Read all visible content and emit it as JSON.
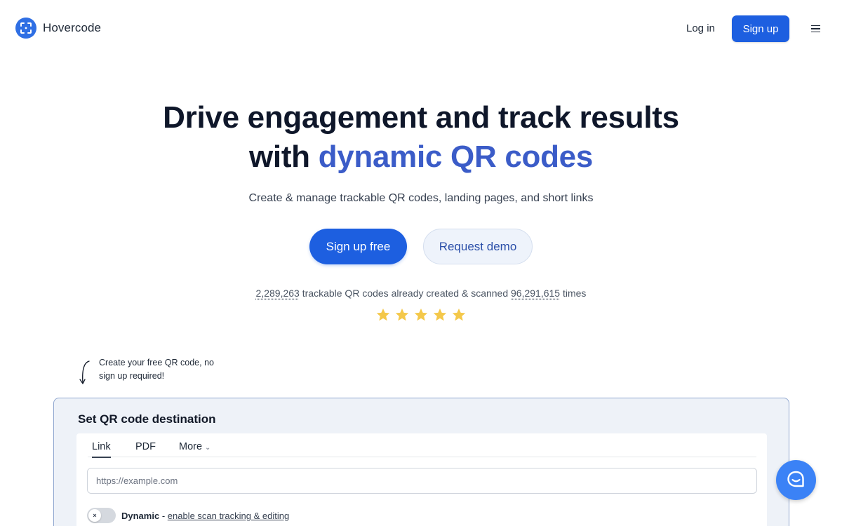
{
  "header": {
    "brand_name": "Hovercode",
    "login_label": "Log in",
    "signup_label": "Sign up"
  },
  "hero": {
    "title_line1": "Drive engagement and track results",
    "title_line2_prefix": "with ",
    "title_line2_accent": "dynamic QR codes",
    "subtitle": "Create & manage trackable QR codes, landing pages, and short links",
    "cta_primary": "Sign up free",
    "cta_secondary": "Request demo",
    "stats": {
      "codes_count": "2,289,263",
      "codes_text": " trackable QR codes already created & scanned ",
      "scans_count": "96,291,615",
      "scans_text": " times"
    },
    "rating_stars": 5
  },
  "annotation": {
    "hint": "Create your free QR code, no sign up required!"
  },
  "generator": {
    "title": "Set QR code destination",
    "tabs": [
      {
        "label": "Link",
        "active": true
      },
      {
        "label": "PDF",
        "active": false
      },
      {
        "label": "More",
        "active": false
      }
    ],
    "url_placeholder": "https://example.com",
    "dynamic_label": "Dynamic",
    "dynamic_separator": " - ",
    "dynamic_link": "enable scan tracking & editing",
    "toggle_knob": "×"
  },
  "colors": {
    "accent": "#1d5fe0",
    "title_accent": "#3b5cc8",
    "star": "#f4c84a",
    "chat": "#3b82f6"
  },
  "icons": {
    "logo": "qr-scan-logo-icon",
    "menu": "hamburger-menu-icon",
    "star": "star-icon",
    "chat": "chat-bubble-icon",
    "arrow": "curved-arrow-down-icon",
    "chevron": "chevron-down-icon"
  }
}
